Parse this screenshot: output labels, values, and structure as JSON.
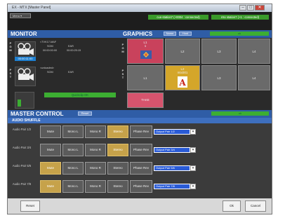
{
  "window": {
    "title": "EX - MTX [Master Panel]",
    "minimize": "–",
    "maximize": "□",
    "close": "✕"
  },
  "menubar": {
    "menu_label": "Menu ▾",
    "status_left": "cue-station7 (+0004 : connected)",
    "status_right": "mtx station7 (+1 : connected)"
  },
  "monitor": {
    "title": "MONITOR",
    "pgm_label": "P G M",
    "pst_label": "P S T",
    "pgm": {
      "name": "<TVK17-MAF",
      "som_label": "SOM",
      "eom_label": "EAR",
      "som_value": "00:00:00:00",
      "eom_value": "00:00:25:15",
      "timecode": "00:00:11:00"
    },
    "pst": {
      "name": "<unloaded>",
      "som_label": "SOM",
      "eom_label": "EAR"
    },
    "quickclip": "Quickclip OK"
  },
  "graphics": {
    "title": "GRAPHICS",
    "btn1": "Name",
    "btn2": "Host",
    "status": "ok",
    "pgm_label": "P G M",
    "pst_label": "P S T",
    "pgm": [
      "L1",
      "L2",
      "L3",
      "L4"
    ],
    "pgm_sub": "1",
    "pst": [
      "L1",
      "L2",
      "L3",
      "L4"
    ],
    "pst_sub": "L2\nmtx001",
    "take": "TAKE",
    "colors": {
      "take": "#d6546d",
      "l1_pgm": "#c9425c",
      "l2_pst": "#d4a62a"
    }
  },
  "master": {
    "title": "MASTER CONTROL",
    "btn": "Reset",
    "status": "ok",
    "audio_title": "AUDIO SHUFFLE",
    "rows": [
      {
        "label": "Audio Pair 1/2",
        "buttons": [
          "Mute",
          "Mono L",
          "Mono R",
          "Stereo",
          "Phase Rev"
        ],
        "on": [
          3
        ],
        "select": "Output Pair 1/2"
      },
      {
        "label": "Audio Pair 3/4",
        "buttons": [
          "Mute",
          "Mono L",
          "Mono R",
          "Stereo",
          "Phase Rev"
        ],
        "on": [
          3
        ],
        "select": "Output Pair 3/4"
      },
      {
        "label": "Audio Pair 5/6",
        "buttons": [
          "Mute",
          "Mono L",
          "Mono R",
          "Stereo",
          "Phase Rev"
        ],
        "on": [
          0
        ],
        "select": "Output Pair 5/6"
      },
      {
        "label": "Audio Pair 7/8",
        "buttons": [
          "Mute",
          "Mono L",
          "Mono R",
          "Stereo",
          "Phase Rev"
        ],
        "on": [
          0
        ],
        "select": "Output Pair 7/8"
      }
    ]
  },
  "footer": {
    "reset": "Reset",
    "ok": "Ok",
    "cancel": "Cancel"
  }
}
